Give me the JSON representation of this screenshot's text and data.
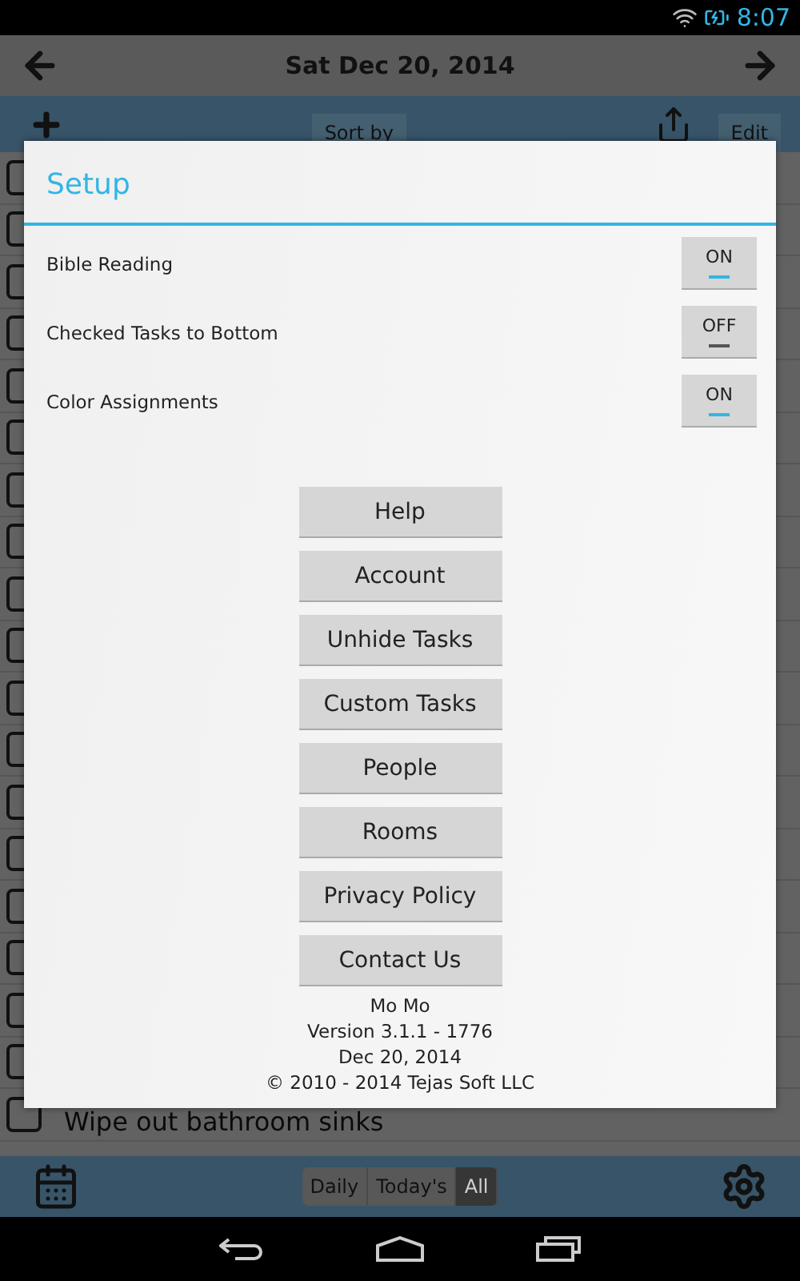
{
  "status_bar": {
    "time": "8:07"
  },
  "header": {
    "title": "Sat Dec 20, 2014"
  },
  "toolbar": {
    "sort_button": "Sort by",
    "edit_button": "Edit"
  },
  "tasks": [
    {
      "label": "Wipe out bathroom sinks",
      "checked": false
    }
  ],
  "bottom_bar": {
    "filters": [
      {
        "label": "Daily",
        "selected": false
      },
      {
        "label": "Today's",
        "selected": false
      },
      {
        "label": "All",
        "selected": true
      }
    ]
  },
  "dialog": {
    "title": "Setup",
    "settings": [
      {
        "label": "Bible Reading",
        "on": true,
        "toggle_text": "ON"
      },
      {
        "label": "Checked Tasks to Bottom",
        "on": false,
        "toggle_text": "OFF"
      },
      {
        "label": "Color Assignments",
        "on": true,
        "toggle_text": "ON"
      }
    ],
    "buttons": [
      "Help",
      "Account",
      "Unhide Tasks",
      "Custom Tasks",
      "People",
      "Rooms",
      "Privacy Policy",
      "Contact Us"
    ],
    "footer": [
      "Mo Mo",
      "Version 3.1.1 - 1776",
      "Dec 20, 2014",
      "© 2010 - 2014 Tejas Soft LLC"
    ]
  }
}
